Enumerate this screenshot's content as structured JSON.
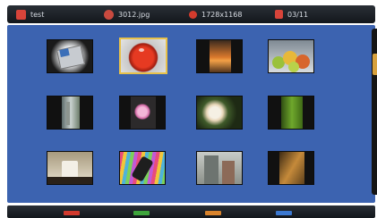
{
  "topbar": {
    "folder_label": "test",
    "file_label": "3012.jpg",
    "resolution_label": "1728x1168",
    "count_label": "03/11",
    "icons": [
      "folder-icon",
      "image-file-icon",
      "resolution-icon",
      "page-count-icon"
    ]
  },
  "thumbnails": [
    {
      "subject": "folder with photos",
      "selected": false
    },
    {
      "subject": "red tomato",
      "selected": true
    },
    {
      "subject": "orange fruit",
      "selected": false
    },
    {
      "subject": "fruit bowl",
      "selected": false
    },
    {
      "subject": "building",
      "selected": false
    },
    {
      "subject": "pink flower",
      "selected": false
    },
    {
      "subject": "white rose",
      "selected": false
    },
    {
      "subject": "green plant",
      "selected": false
    },
    {
      "subject": "mug",
      "selected": false
    },
    {
      "subject": "colorful stripes",
      "selected": false
    },
    {
      "subject": "city street",
      "selected": false
    },
    {
      "subject": "dark room",
      "selected": false
    }
  ],
  "scroll": {
    "position_fraction": 0.2
  },
  "color_keys": [
    "#d23a2e",
    "#3ea53c",
    "#d8832c",
    "#3b78d0"
  ],
  "colors": {
    "panel": "#3c63b0",
    "selection": "#e7c14b",
    "bar": "#1b1f25"
  }
}
